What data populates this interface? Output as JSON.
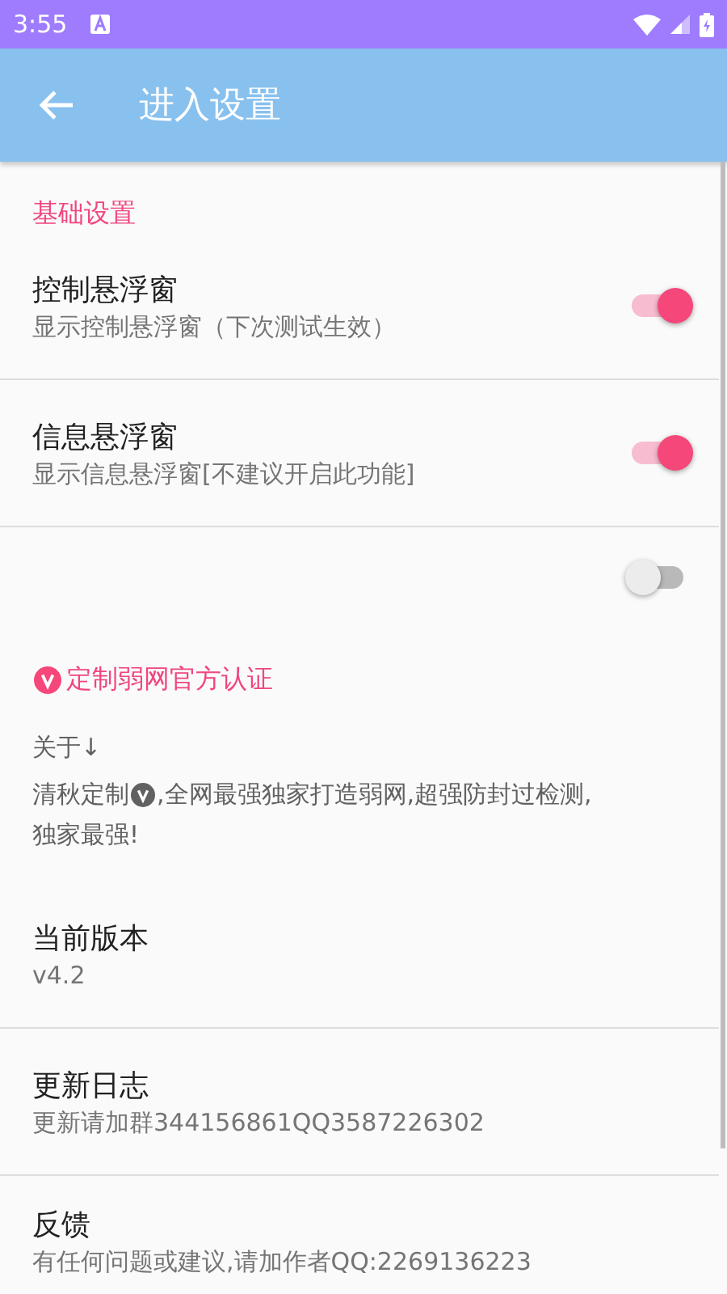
{
  "status_bar": {
    "time": "3:55"
  },
  "app_bar": {
    "title": "进入设置"
  },
  "items": [
    {
      "kind": "header",
      "title": "基础设置",
      "badge": false
    },
    {
      "kind": "switch",
      "title": "控制悬浮窗",
      "summary": "显示控制悬浮窗（下次测试生效）",
      "on": true
    },
    {
      "kind": "switch",
      "title": "信息悬浮窗",
      "summary": "显示信息悬浮窗[不建议开启此功能]",
      "on": true
    },
    {
      "kind": "switch",
      "on": false
    },
    {
      "kind": "header",
      "title": "定制弱网官方认证",
      "badge": true
    },
    {
      "kind": "about",
      "intro": "关于↓",
      "before": "清秋定制",
      "after": [
        ",全网最强独家打造弱网,超强防封过检测,",
        "独家最强!"
      ]
    },
    {
      "kind": "text",
      "title": "当前版本",
      "summary": "v4.2"
    },
    {
      "kind": "text",
      "title": "更新日志",
      "summary": "更新请加群344156861QQ3587226302"
    },
    {
      "kind": "text",
      "title": "反馈",
      "summary": "有任何问题或建议,请加作者QQ:2269136223"
    }
  ]
}
